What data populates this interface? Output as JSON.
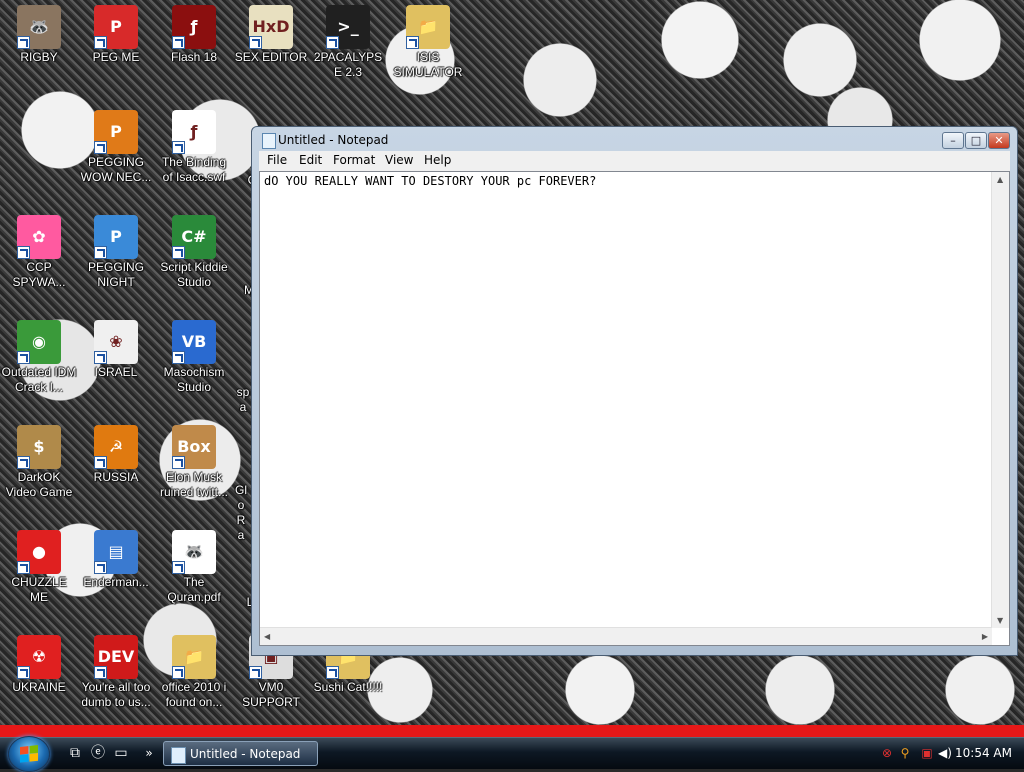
{
  "desktop": {
    "icons": [
      {
        "label": "RIGBY",
        "icon": "raccoon-icon",
        "color": "#8a7560"
      },
      {
        "label": "PEG ME",
        "icon": "p-logo-icon",
        "color": "#d82a2a"
      },
      {
        "label": "Flash 18",
        "icon": "flash-icon",
        "color": "#8b0f0f"
      },
      {
        "label": "SEX EDITOR",
        "icon": "hxd-icon",
        "color": "#e8e0c0"
      },
      {
        "label": "2PACALYPSE 2.3",
        "icon": "terminal-icon",
        "color": "#202020"
      },
      {
        "label": "ISIS SIMULATOR",
        "icon": "folder-icon",
        "color": "#e0c060"
      },
      {
        "label": "PEGGING WOW NEC...",
        "icon": "p-logo-icon",
        "color": "#e07a18"
      },
      {
        "label": "The Binding of Isacc.swf",
        "icon": "flash-file-icon",
        "color": "#ffffff"
      },
      {
        "label": "CCP SPYWA...",
        "icon": "color-wheel-icon",
        "color": "#ff5aa0"
      },
      {
        "label": "PEGGING NIGHT",
        "icon": "p-logo-icon",
        "color": "#3a8ad8"
      },
      {
        "label": "Script Kiddie Studio",
        "icon": "csharp-icon",
        "color": "#2a8a3a"
      },
      {
        "label": "Outdated IDM Crack I...",
        "icon": "globe-download-icon",
        "color": "#3a9a3a"
      },
      {
        "label": "ISRAEL",
        "icon": "flower-icon",
        "color": "#f0f0f0"
      },
      {
        "label": "Masochism Studio",
        "icon": "vb-icon",
        "color": "#2a6ad0"
      },
      {
        "label": "DarkOK Video Game",
        "icon": "money-bag-icon",
        "color": "#b08a4a"
      },
      {
        "label": "RUSSIA",
        "icon": "hammer-sickle-icon",
        "color": "#e07a10"
      },
      {
        "label": "Elon Musk ruined twitt...",
        "icon": "doge-box-icon",
        "color": "#c08a4a"
      },
      {
        "label": "CHUZZLE ME",
        "icon": "chuzzle-icon",
        "color": "#e02020"
      },
      {
        "label": "Enderman...",
        "icon": "window-icon",
        "color": "#3a7ad0"
      },
      {
        "label": "The Quran.pdf",
        "icon": "raccoon-file-icon",
        "color": "#ffffff"
      },
      {
        "label": "UKRAINE",
        "icon": "radiation-icon",
        "color": "#e02020"
      },
      {
        "label": "You're all too dumb to us...",
        "icon": "dev-cpp-icon",
        "color": "#d01a1a"
      },
      {
        "label": "office 2010 i found on...",
        "icon": "folder-icon",
        "color": "#e0c060"
      },
      {
        "label": "VM0 SUPPORT",
        "icon": "vm-icon",
        "color": "#dddddd"
      },
      {
        "label": "Sushi Cat!!!!!",
        "icon": "folder-icon",
        "color": "#e0c060"
      }
    ],
    "partial_labels": [
      "C",
      "M",
      "spa",
      "Glo Ra",
      "L"
    ]
  },
  "notepad": {
    "title": "Untitled - Notepad",
    "menu": [
      "File",
      "Edit",
      "Format",
      "View",
      "Help"
    ],
    "content": "dO YOU REALLY WANT TO DESTORY YOUR pc FOREVER?",
    "minimize": "–",
    "maximize": "□",
    "close": "✕"
  },
  "taskbar": {
    "task_label": "Untitled - Notepad",
    "clock": "10:54 AM",
    "chevron": "»",
    "accent_red": "#e61818"
  }
}
